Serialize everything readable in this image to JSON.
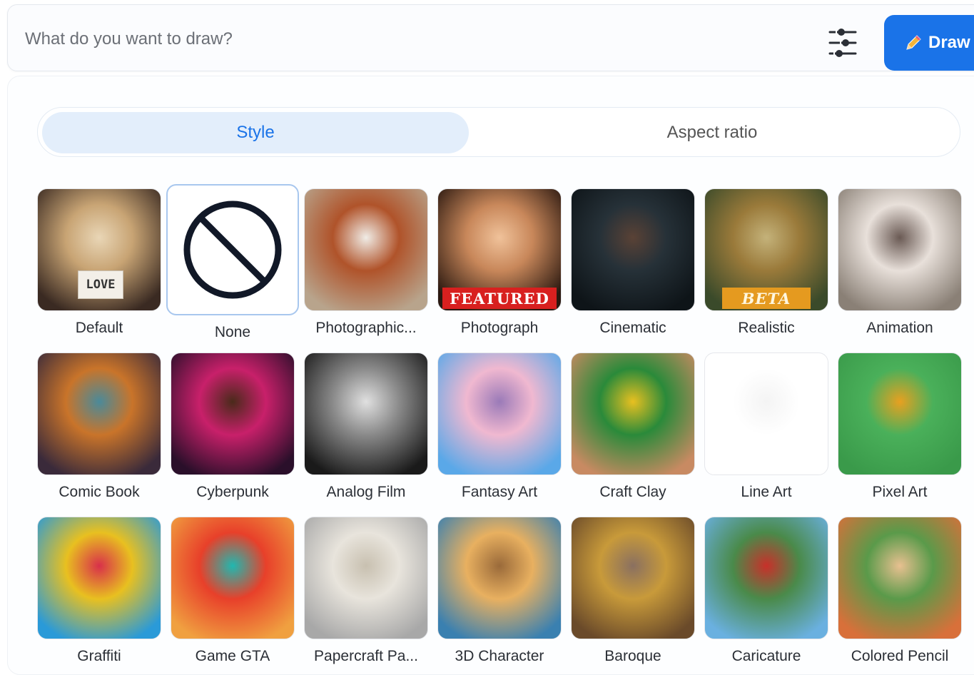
{
  "search": {
    "placeholder": "What do you want to draw?"
  },
  "draw_button": {
    "label": "Draw"
  },
  "tabs": [
    {
      "label": "Style",
      "active": true
    },
    {
      "label": "Aspect ratio",
      "active": false
    }
  ],
  "styles": [
    {
      "label": "Default",
      "badge": "LOVE",
      "colors": [
        "#3a2a22",
        "#c8a474",
        "#e9d6b6"
      ]
    },
    {
      "label": "None",
      "selected": true
    },
    {
      "label": "Photographic...",
      "colors": [
        "#b8a48c",
        "#b0532a",
        "#f0ece6"
      ]
    },
    {
      "label": "Photograph",
      "badge": "FEATURED",
      "colors": [
        "#2a1810",
        "#c8875a",
        "#f0c29a"
      ]
    },
    {
      "label": "Cinematic",
      "colors": [
        "#0e1418",
        "#263138",
        "#5a4236"
      ]
    },
    {
      "label": "Realistic",
      "badge": "BETA",
      "colors": [
        "#3a4a2a",
        "#9a7a3a",
        "#c4b27a"
      ]
    },
    {
      "label": "Animation",
      "colors": [
        "#8a8076",
        "#e8e0da",
        "#6a5a54"
      ]
    },
    {
      "label": "Comic Book",
      "colors": [
        "#3a2a3a",
        "#c9742a",
        "#4a8a9a"
      ]
    },
    {
      "label": "Cyberpunk",
      "colors": [
        "#2a0f2a",
        "#c8206a",
        "#4a2a1a"
      ]
    },
    {
      "label": "Analog Film",
      "colors": [
        "#1a1a1a",
        "#8a8a8a",
        "#e0e0e0"
      ]
    },
    {
      "label": "Fantasy Art",
      "colors": [
        "#5aa8e8",
        "#f0b8d0",
        "#9a7ab8"
      ]
    },
    {
      "label": "Craft Clay",
      "colors": [
        "#c88a62",
        "#2a8a3a",
        "#e8c020"
      ]
    },
    {
      "label": "Line Art",
      "colors": [
        "#ffffff",
        "#ffffff",
        "#f4f4f4"
      ]
    },
    {
      "label": "Pixel Art",
      "colors": [
        "#3a9a4a",
        "#4ab05a",
        "#e8a020"
      ]
    },
    {
      "label": "Graffiti",
      "colors": [
        "#2a9ad8",
        "#e8c020",
        "#d8304a"
      ]
    },
    {
      "label": "Game GTA",
      "colors": [
        "#f0a040",
        "#e8402a",
        "#20b8b0"
      ]
    },
    {
      "label": "Papercraft Pa...",
      "colors": [
        "#a8a8a8",
        "#e8e4dc",
        "#c8c0b0"
      ]
    },
    {
      "label": "3D Character",
      "colors": [
        "#3a80b0",
        "#e8b060",
        "#9a6a3a"
      ]
    },
    {
      "label": "Baroque",
      "colors": [
        "#6a4a2a",
        "#c89a3a",
        "#8a7060"
      ]
    },
    {
      "label": "Caricature",
      "colors": [
        "#6ab0e0",
        "#4a8a4a",
        "#c8302a"
      ]
    },
    {
      "label": "Colored Pencil",
      "colors": [
        "#d8703a",
        "#5a9a4a",
        "#e8c090"
      ]
    }
  ]
}
